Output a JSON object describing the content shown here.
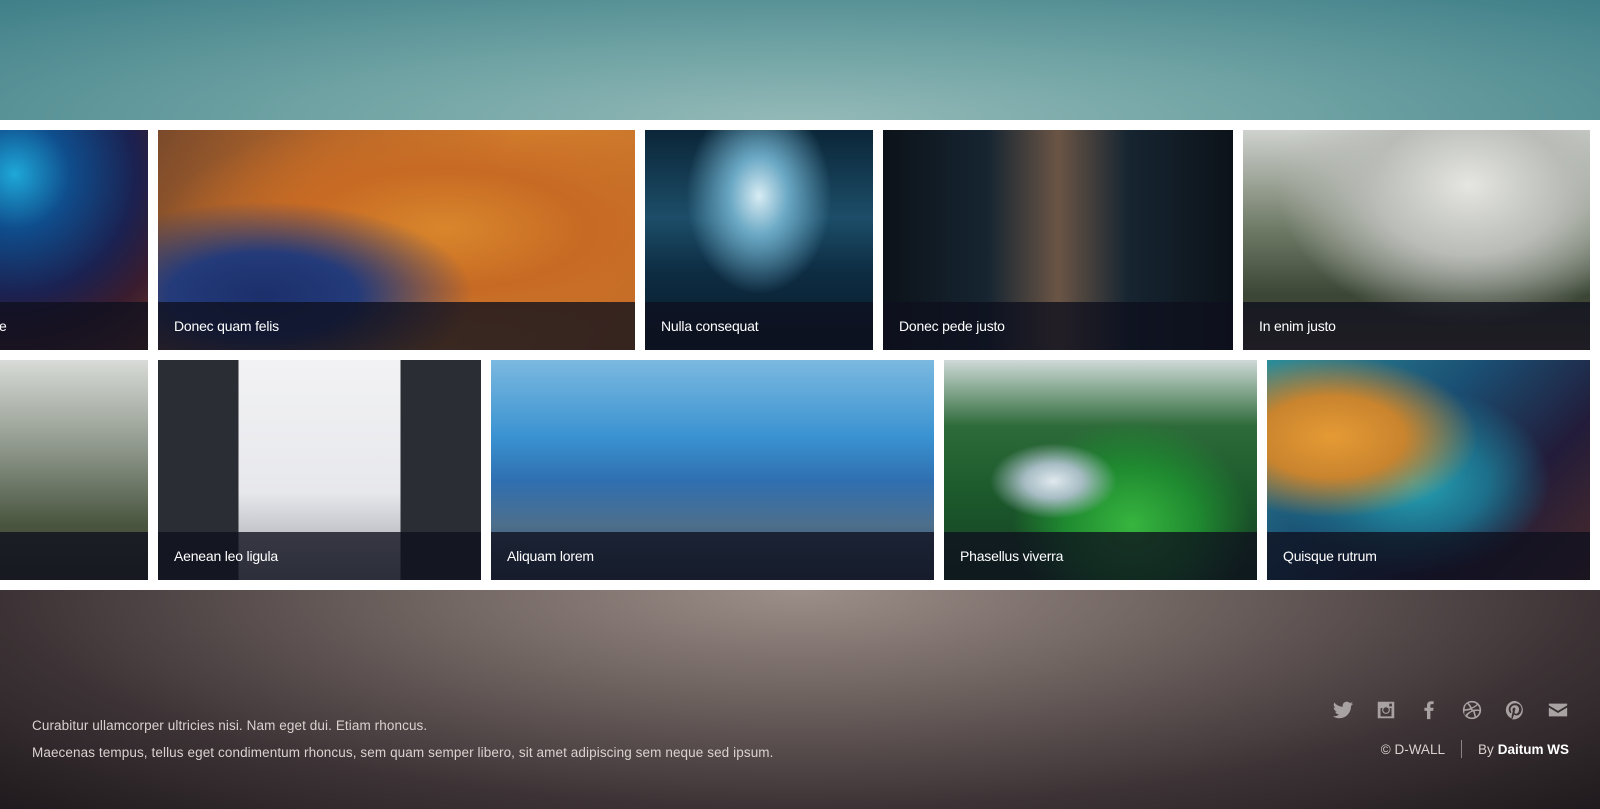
{
  "gallery": {
    "items": [
      {
        "caption": "e",
        "image": "abstract-space-crop"
      },
      {
        "caption": "Donec quam felis",
        "image": "mars-crater"
      },
      {
        "caption": "Nulla consequat",
        "image": "stormy-clouds-sea"
      },
      {
        "caption": "Donec pede justo",
        "image": "train-station"
      },
      {
        "caption": "In enim justo",
        "image": "misty-forest-valley"
      },
      {
        "caption": "",
        "image": "misty-forest-crop"
      },
      {
        "caption": "Aenean leo ligula",
        "image": "skyscrapers-looking-up"
      },
      {
        "caption": "Aliquam lorem",
        "image": "blue-fjord"
      },
      {
        "caption": "Phasellus viverra",
        "image": "forest-waterfall"
      },
      {
        "caption": "Quisque rutrum",
        "image": "aerial-colorful-coast"
      }
    ]
  },
  "footer": {
    "line1": "Curabitur ullamcorper ultricies nisi. Nam eget dui. Etiam rhoncus.",
    "line2": "Maecenas tempus, tellus eget condimentum rhoncus, sem quam semper libero, sit amet adipiscing sem neque sed ipsum.",
    "copyright": "© D-WALL",
    "by_label": "By",
    "by_name": "Daitum WS"
  },
  "social": [
    "twitter-icon",
    "instagram-icon",
    "facebook-icon",
    "dribbble-icon",
    "pinterest-icon",
    "email-icon"
  ],
  "colors": {
    "caption_bg": "#0e101e",
    "footer_text": "#d9d2cf",
    "icon": "#a8a2a3"
  }
}
